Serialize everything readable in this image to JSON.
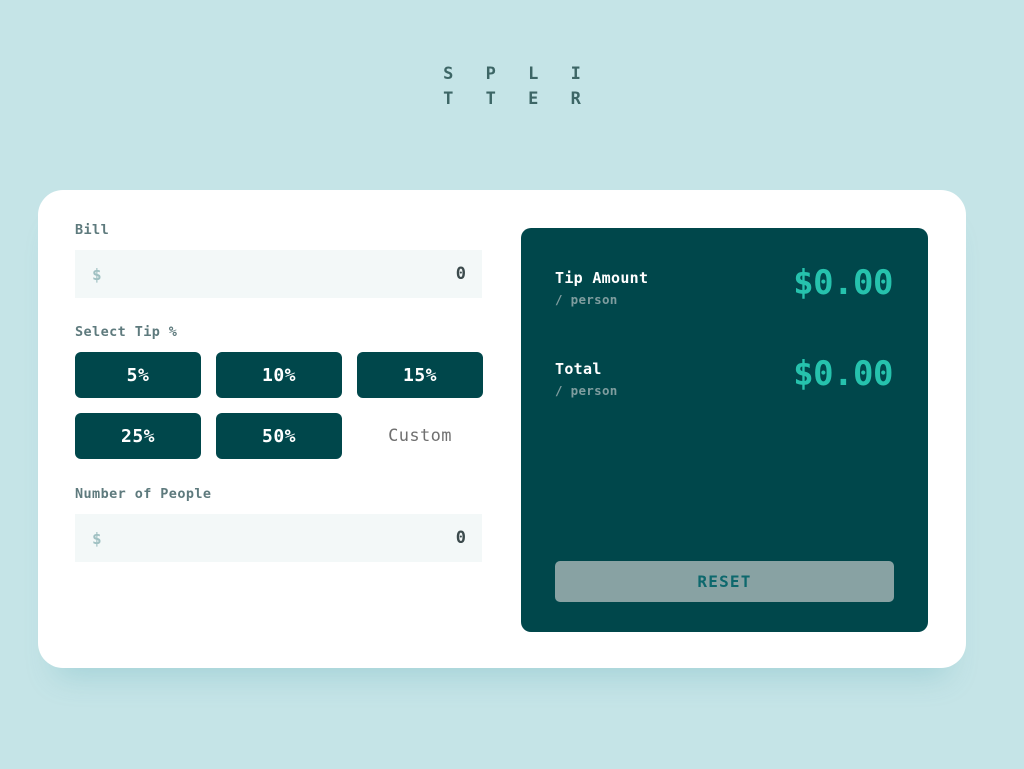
{
  "app": {
    "title_lines": [
      "S P L I",
      "T T E R"
    ],
    "background_color": "#c5e4e7",
    "card_color": "#ffffff",
    "accent_dark": "#00474b",
    "accent_bright": "#26c2ad",
    "input_bg": "#f3f8f8"
  },
  "bill": {
    "label": "Bill",
    "currency_icon": "$",
    "value": "0",
    "placeholder": "0"
  },
  "tip": {
    "label": "Select Tip %",
    "options": [
      {
        "label": "5%",
        "value": 5
      },
      {
        "label": "10%",
        "value": 10
      },
      {
        "label": "15%",
        "value": 15
      },
      {
        "label": "25%",
        "value": 25
      },
      {
        "label": "50%",
        "value": 50
      }
    ],
    "custom_label": "Custom",
    "custom_placeholder": "Custom"
  },
  "people": {
    "label": "Number of People",
    "currency_icon": "$",
    "value": "0",
    "placeholder": "0"
  },
  "results": {
    "tip_amount": {
      "title": "Tip Amount",
      "sub": "/ person",
      "amount": "$0.00"
    },
    "total": {
      "title": "Total",
      "sub": "/ person",
      "amount": "$0.00"
    },
    "reset_label": "RESET"
  }
}
